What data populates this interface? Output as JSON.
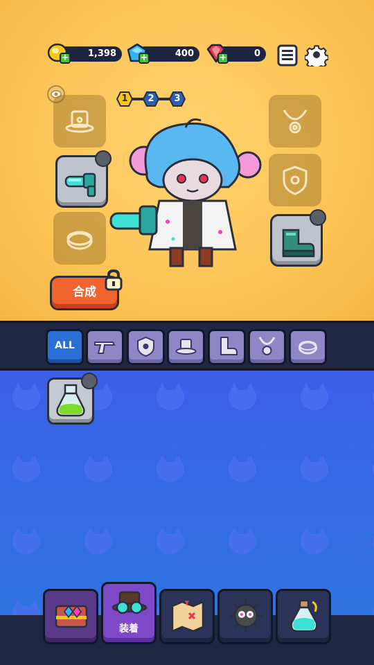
{
  "resources": {
    "gold": "1,398",
    "crystal": "400",
    "ruby": "0"
  },
  "levels": [
    "1",
    "2",
    "3"
  ],
  "craft_label": "合成",
  "filters": {
    "all_label": "ALL",
    "categories": [
      "weapon",
      "armor",
      "hat",
      "boots",
      "necklace",
      "ring"
    ]
  },
  "nav": {
    "active_label": "装着"
  },
  "colors": {
    "accent_orange": "#f2642f",
    "top_bg": "#fcc456",
    "inventory_bg": "#3b5fe8",
    "nav_bg": "#1f2743",
    "active_tab": "#2b6ed6",
    "active_nav": "#7d49c8"
  }
}
